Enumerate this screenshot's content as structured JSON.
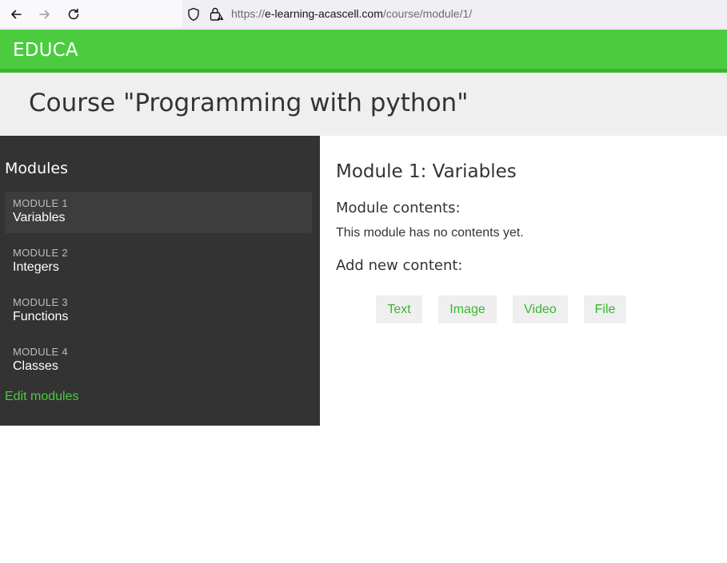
{
  "browser": {
    "url_scheme": "https://",
    "url_host": "e-learning-acascell.com",
    "url_path": "/course/module/1/"
  },
  "header": {
    "logo": "EDUCA"
  },
  "course": {
    "title": "Course \"Programming with python\""
  },
  "sidebar": {
    "heading": "Modules",
    "modules": [
      {
        "number": "MODULE 1",
        "name": "Variables",
        "active": true
      },
      {
        "number": "MODULE 2",
        "name": "Integers",
        "active": false
      },
      {
        "number": "MODULE 3",
        "name": "Functions",
        "active": false
      },
      {
        "number": "MODULE 4",
        "name": "Classes",
        "active": false
      }
    ],
    "edit_link": "Edit modules"
  },
  "main": {
    "module_title": "Module 1: Variables",
    "contents_heading": "Module contents:",
    "empty_text": "This module has no contents yet.",
    "add_heading": "Add new content:",
    "content_buttons": [
      "Text",
      "Image",
      "Video",
      "File"
    ]
  },
  "colors": {
    "brand_green": "#4ccb3f",
    "sidebar_bg": "#333333",
    "band_bg": "#efefef"
  }
}
